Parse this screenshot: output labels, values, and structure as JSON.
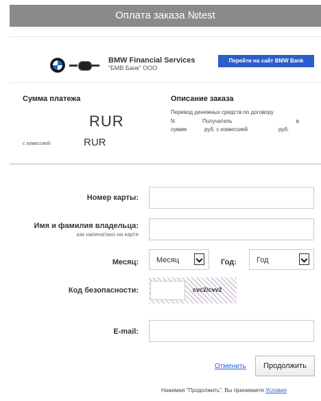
{
  "header": {
    "title": "Оплата заказа №test"
  },
  "brand": {
    "title": "BMW Financial Services",
    "subtitle": "“БМВ Банк” ООО",
    "bank_link": "Перейти на сайт BMW Bank"
  },
  "payment": {
    "sum_label": "Сумма платежа",
    "currency": "RUR",
    "commission_label": "с комиссией:",
    "commission_currency": "RUR"
  },
  "description": {
    "title": "Описание заказа",
    "line1": "Перевод денежных средств по договору",
    "line2_n": "N",
    "line2_recipient": "Получатель",
    "line2_v": "в",
    "line3_sum": "сумме",
    "line3_middle": "руб. с комиссией",
    "line3_end": "руб."
  },
  "form": {
    "card_number_label": "Номер карты:",
    "holder_label": "Имя и фамилия владельца:",
    "holder_hint": "как напечатано на карте",
    "month_label": "Месяц:",
    "month_value": "Месяц",
    "year_label": "Год:",
    "year_value": "Год",
    "cvv_label": "Код безопасности:",
    "cvv_hint": "cvc2/cvv2",
    "email_label": "E-mail:"
  },
  "actions": {
    "cancel": "Отменить",
    "continue": "Продолжить"
  },
  "terms": {
    "text": "Нажимая \"Продолжить\", Вы принимаете",
    "link": "Условия"
  },
  "colors": {
    "header_bg": "#8a8a8a",
    "link": "#2a62c9",
    "bank_button": "#2b5ec9"
  }
}
